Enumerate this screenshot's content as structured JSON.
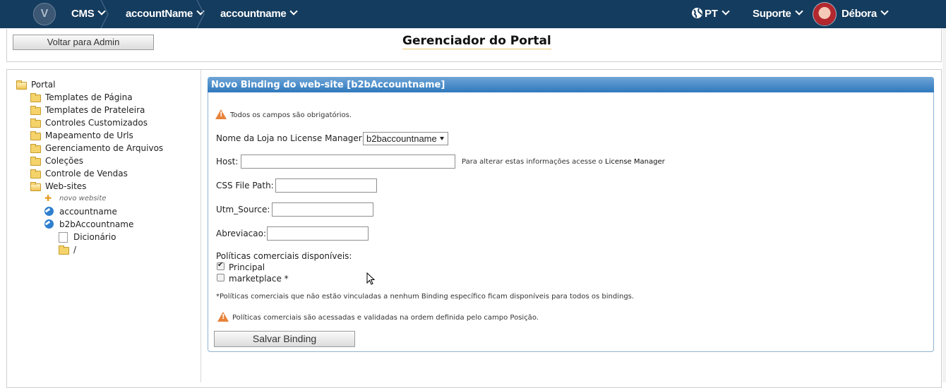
{
  "topbar": {
    "logo_letter": "V",
    "cms_label": "CMS",
    "account_label": "accountName",
    "store_label": "accountname",
    "lang_label": "PT",
    "support_label": "Suporte",
    "user_label": "Débora"
  },
  "header": {
    "back_button": "Voltar para Admin",
    "title": "Gerenciador do Portal"
  },
  "tree": {
    "root": "Portal",
    "items": [
      "Templates de Página",
      "Templates de Prateleira",
      "Controles Customizados",
      "Mapeamento de Urls",
      "Gerenciamento de Arquivos",
      "Coleções",
      "Controle de Vendas",
      "Web-sites"
    ],
    "websites": {
      "new": "novo website",
      "site1": "accountname",
      "site2": "b2bAccountname",
      "sub1": "Dicionário",
      "sub2": "/"
    }
  },
  "form": {
    "header": "Novo Binding do web-site [b2bAccountname]",
    "required_note": "Todos os campos são obrigatórios.",
    "store_label": "Nome da Loja no License Manager:",
    "store_value": "b2baccountname",
    "host_label": "Host:",
    "host_hint_prefix": "Para alterar estas informações acesse o",
    "host_hint_link": "License Manager",
    "css_label": "CSS File Path:",
    "utm_label": "Utm_Source:",
    "abrev_label": "Abreviacao:",
    "policies_title": "Políticas comerciais disponíveis:",
    "policy1": "Principal",
    "policy2": "marketplace *",
    "footnote": "*Políticas comerciais que não estão vinculadas a nenhum Binding específico ficam disponíveis para todos os bindings.",
    "order_note": "Políticas comerciais são acessadas e validadas na ordem definida pelo campo Posição.",
    "save_button": "Salvar Binding"
  },
  "colors": {
    "topbar": "#143c5e",
    "panel_header": "#2f78bd",
    "warning": "#e8823a"
  }
}
